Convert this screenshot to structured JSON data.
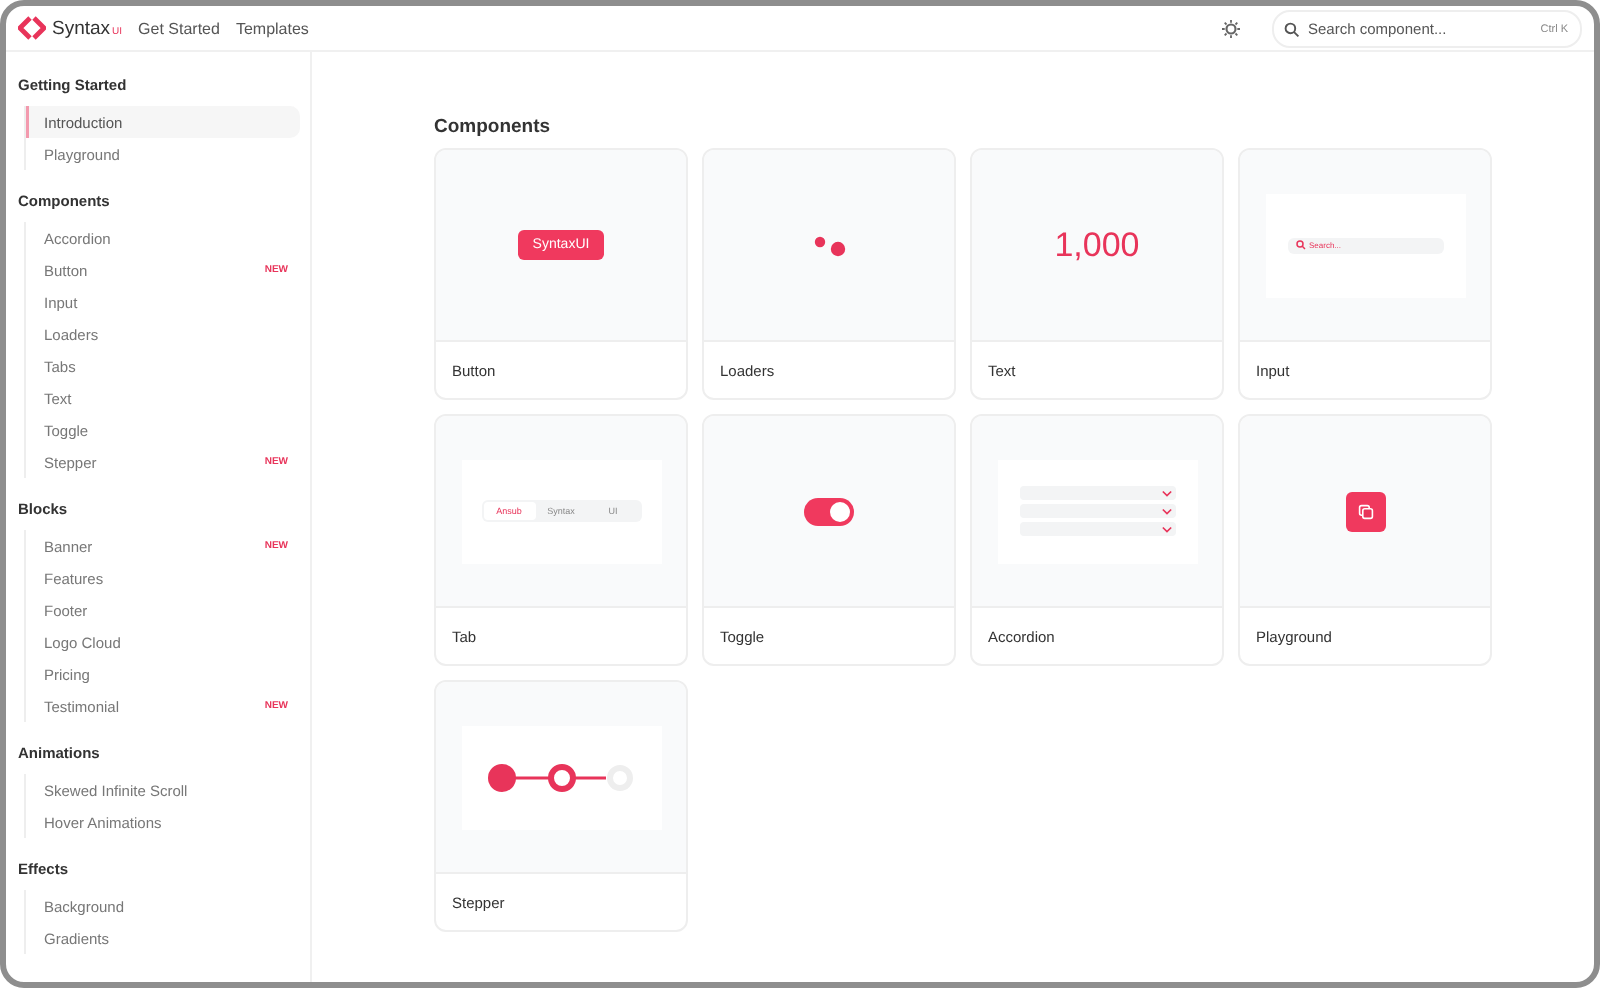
{
  "header": {
    "brand": "Syntax",
    "brand_badge": "UI",
    "nav": [
      "Get Started",
      "Templates"
    ],
    "search": {
      "placeholder": "Search component...",
      "shortcut": "Ctrl K"
    }
  },
  "sidebar": {
    "sections": [
      {
        "title": "Getting Started",
        "items": [
          {
            "label": "Introduction",
            "selected": true
          },
          {
            "label": "Playground",
            "selected": false
          }
        ]
      },
      {
        "title": "Components",
        "items": [
          {
            "label": "Accordion",
            "selected": false
          },
          {
            "label": "Button",
            "selected": false,
            "badge": "NEW"
          },
          {
            "label": "Input",
            "selected": false
          },
          {
            "label": "Loaders",
            "selected": false
          },
          {
            "label": "Tabs",
            "selected": false
          },
          {
            "label": "Text",
            "selected": false
          },
          {
            "label": "Toggle",
            "selected": false
          },
          {
            "label": "Stepper",
            "selected": false,
            "badge": "NEW"
          }
        ]
      },
      {
        "title": "Blocks",
        "items": [
          {
            "label": "Banner",
            "selected": false,
            "badge": "NEW"
          },
          {
            "label": "Features",
            "selected": false
          },
          {
            "label": "Footer",
            "selected": false
          },
          {
            "label": "Logo Cloud",
            "selected": false
          },
          {
            "label": "Pricing",
            "selected": false
          },
          {
            "label": "Testimonial",
            "selected": false,
            "badge": "NEW"
          }
        ]
      },
      {
        "title": "Animations",
        "items": [
          {
            "label": "Skewed Infinite Scroll",
            "selected": false
          },
          {
            "label": "Hover Animations",
            "selected": false
          }
        ]
      },
      {
        "title": "Effects",
        "items": [
          {
            "label": "Background",
            "selected": false
          },
          {
            "label": "Gradients",
            "selected": false
          }
        ]
      }
    ]
  },
  "main": {
    "heading": "Components",
    "cards": [
      {
        "title": "Button",
        "kind": "button",
        "preview_text": "SyntaxUI"
      },
      {
        "title": "Loaders",
        "kind": "loader"
      },
      {
        "title": "Text",
        "kind": "text",
        "preview_text": "1,000"
      },
      {
        "title": "Input",
        "kind": "input",
        "placeholder": "Search..."
      },
      {
        "title": "Tab",
        "kind": "tabs",
        "tabs": [
          {
            "label": "Ansub",
            "selected": true
          },
          {
            "label": "Syntax",
            "selected": false
          },
          {
            "label": "UI",
            "selected": false
          }
        ]
      },
      {
        "title": "Toggle",
        "kind": "toggle",
        "on": true
      },
      {
        "title": "Accordion",
        "kind": "accordion"
      },
      {
        "title": "Playground",
        "kind": "playground"
      },
      {
        "title": "Stepper",
        "kind": "stepper"
      }
    ]
  }
}
